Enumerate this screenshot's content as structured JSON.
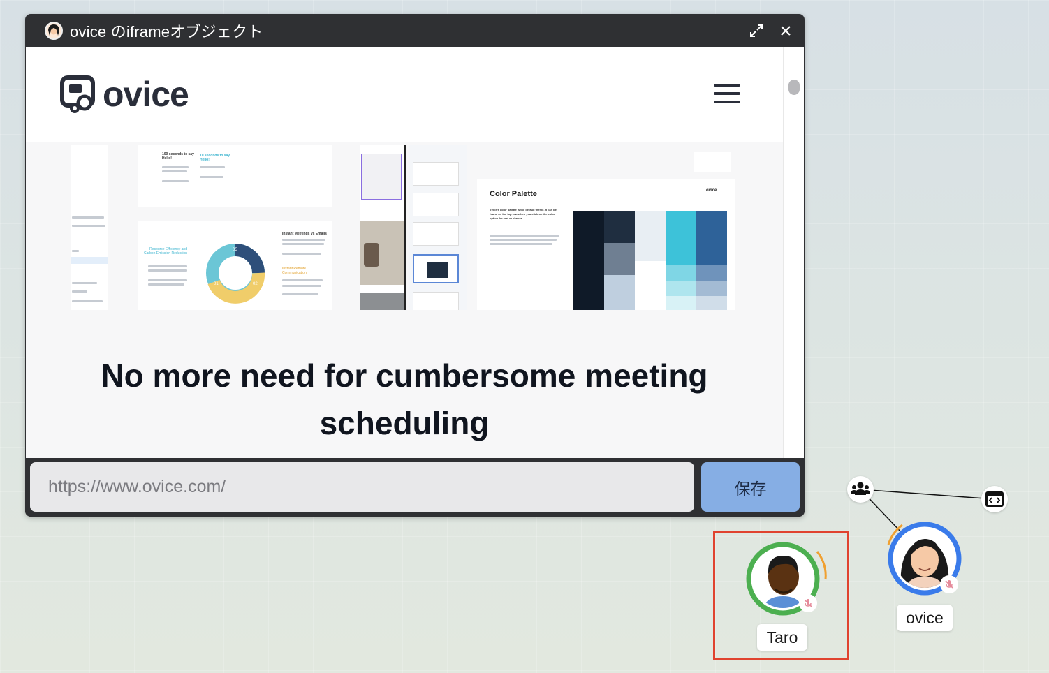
{
  "window": {
    "title": "ovice のiframeオブジェクト",
    "expand_icon": "expand-icon",
    "close_icon": "close-icon"
  },
  "site": {
    "logo_text": "ovice",
    "menu_icon": "hamburger-menu-icon",
    "preview": {
      "card1": {
        "col1_title": "100 seconds to say Hello!",
        "col2_title": "10 seconds to say Hello!"
      },
      "card2": {
        "left_title": "Resource Efficiency and Carbon Emission Reduction",
        "right_title": "Instant Meetings vs Emails",
        "right_subtitle": "Instant Remote Communication",
        "donut_labels": [
          "05",
          "01",
          "02"
        ]
      },
      "palette": {
        "title": "Color Palette",
        "brand": "ovice",
        "body": "oVice's color palette is the default theme. It can be found on the top row when you click on the color option for text or shapes.",
        "swatches": [
          {
            "name": "Black",
            "hex": "#0F1A28"
          },
          {
            "name": "Dark Grey",
            "hex": "#1F2E40"
          },
          {
            "name": "Background",
            "hex": "#E8EEF3"
          },
          {
            "name": "Aqua Blue",
            "hex": "#3DC2D9"
          },
          {
            "name": "Blue Cobalt",
            "hex": "#2E6299"
          }
        ]
      }
    },
    "headline": "No more need for cumbersome meeting scheduling"
  },
  "url_bar": {
    "placeholder": "https://www.ovice.com/",
    "save_label": "保存"
  },
  "avatars": [
    {
      "name": "Taro",
      "ring_color": "#4caf50",
      "mic": "muted",
      "selected": true
    },
    {
      "name": "ovice",
      "ring_color": "#3a7bea",
      "mic": "muted",
      "selected": false
    }
  ],
  "nodes": {
    "group_icon": "users-group-icon",
    "embed_icon": "embed-window-icon"
  },
  "colors": {
    "titlebar": "#2f3033",
    "save_button": "#86aee4",
    "highlight": "#e0432f",
    "speaking_arc": "#f0a030"
  }
}
